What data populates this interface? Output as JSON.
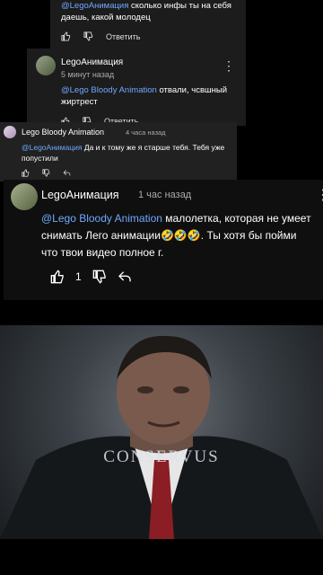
{
  "comment1": {
    "mention": "@LegoАнимация",
    "text": " сколько инфы ты на себя даешь, какой молодец",
    "reply_label": "Ответить"
  },
  "comment2": {
    "author": "LegoАнимация",
    "time": "5 минут назад",
    "mention": "@Lego Bloody Animation",
    "text": " отвали, чсвшный жиртрест",
    "reply_label": "Ответить"
  },
  "comment3": {
    "author": "Lego Bloody Animation",
    "time": "4 часа назад",
    "mention": "@LegoАнимация",
    "text": " Да и к тому же я старше тебя. Тебя уже попустили"
  },
  "comment4": {
    "author": "LegoАнимация",
    "time": "1 час назад",
    "mention": "@Lego Bloody Animation",
    "text": " малолетка, которая не умеет снимать Лего анимации🤣🤣🤣. Ты хотя бы пойми что твои видео полное г.",
    "like_count": "1"
  },
  "video": {
    "watermark": "CONSERVUS"
  },
  "colors": {
    "mention": "#6ea8ff",
    "card_bg": "#1c1c1c"
  }
}
